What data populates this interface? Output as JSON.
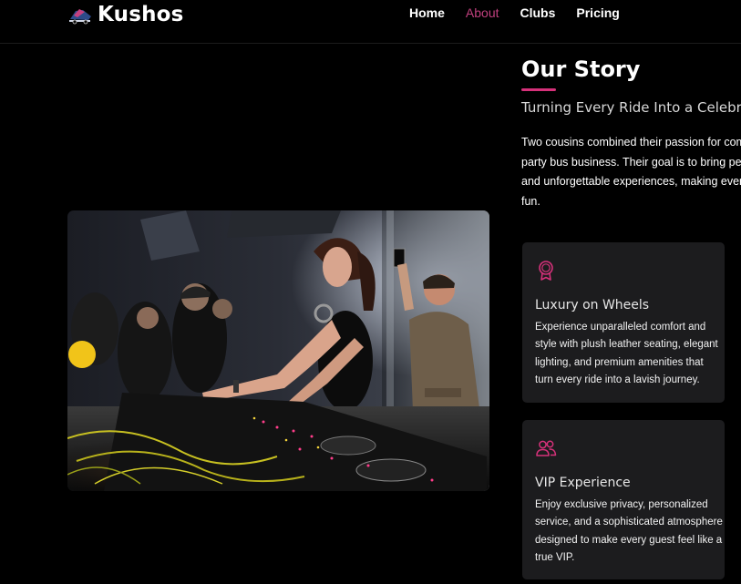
{
  "header": {
    "brand": "Kushos",
    "nav": [
      {
        "label": "Home",
        "active": false
      },
      {
        "label": "About",
        "active": true
      },
      {
        "label": "Clubs",
        "active": false
      },
      {
        "label": "Pricing",
        "active": false
      }
    ]
  },
  "story": {
    "title": "Our Story",
    "subtitle": "Turning Every Ride Into a Celebration",
    "body_lines": [
      "Two cousins combined their passion for community",
      "party bus business. Their goal is to bring people",
      "and unforgettable experiences, making every t",
      "fun."
    ]
  },
  "features": [
    {
      "icon": "award-ribbon-icon",
      "title": "Luxury on Wheels",
      "lines": [
        "Experience unparalleled comfort and",
        "style with plush leather seating, elegant",
        "lighting, and premium amenities that",
        "turn every ride into a lavish journey."
      ]
    },
    {
      "icon": "users-icon",
      "title": "VIP Experience",
      "lines": [
        "Enjoy exclusive privacy, personalized",
        "service, and a sophisticated atmosphere",
        "designed to make every guest feel like a",
        "true VIP."
      ]
    }
  ],
  "colors": {
    "accent": "#d6317a",
    "nav_active": "#c0407e",
    "background": "#000000",
    "card_background": "#1c1c1e"
  }
}
